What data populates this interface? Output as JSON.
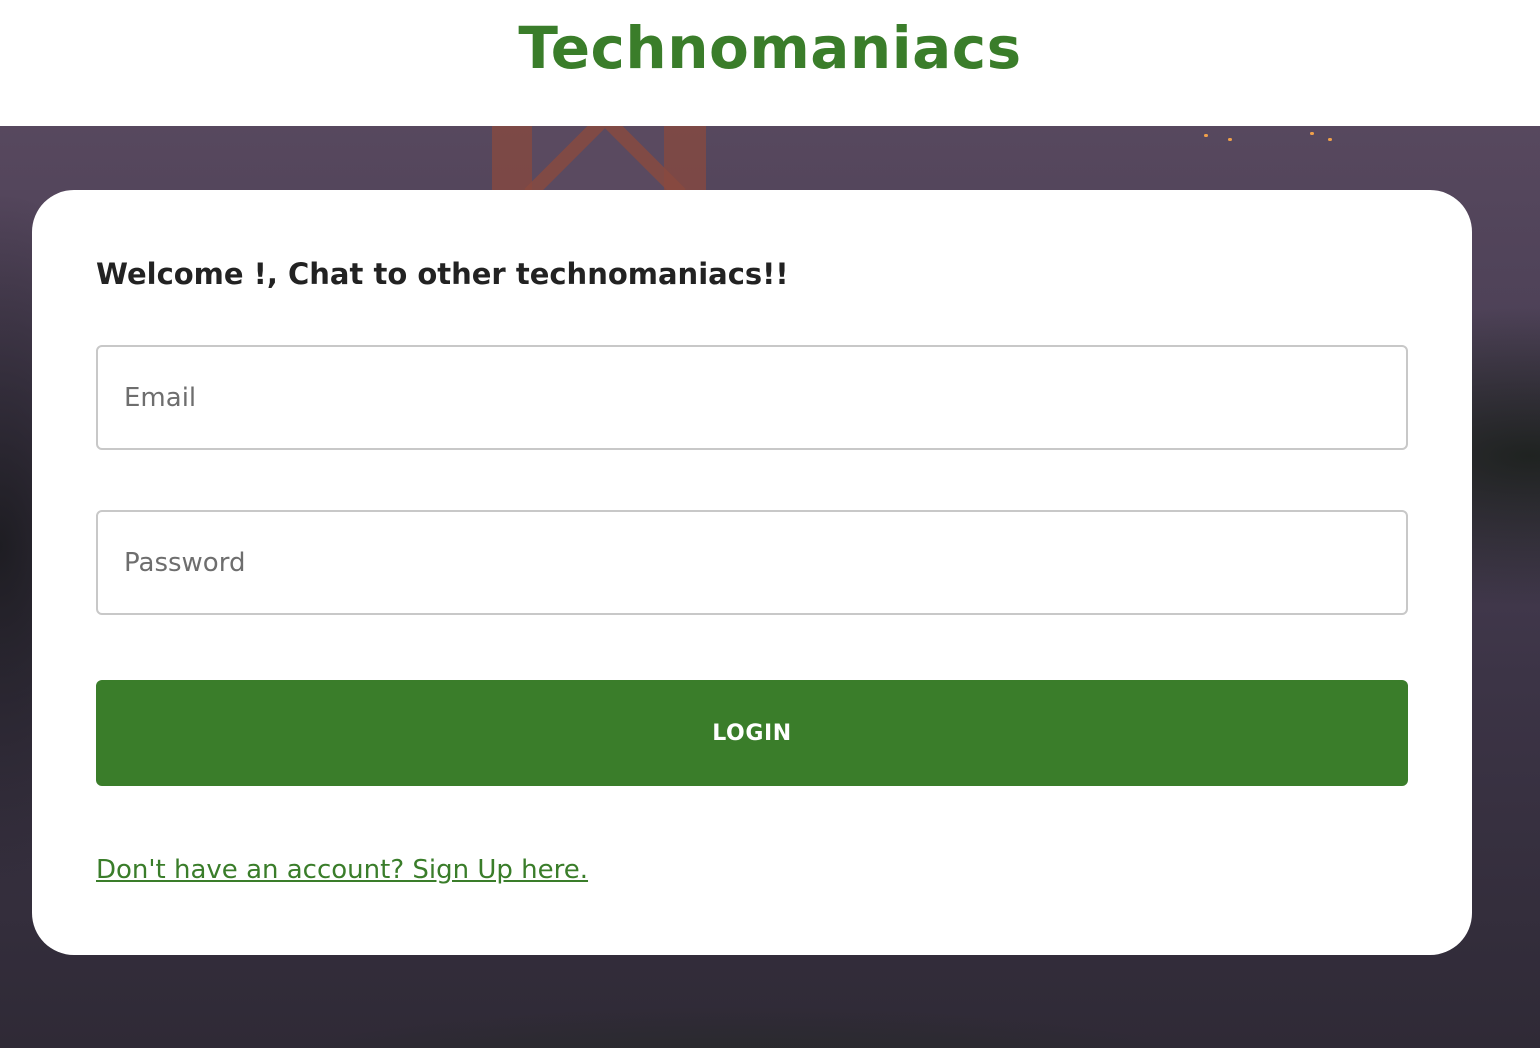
{
  "header": {
    "brand": "Technomaniacs"
  },
  "login_card": {
    "welcome": "Welcome !, Chat to other technomaniacs!!",
    "email": {
      "placeholder": "Email",
      "value": ""
    },
    "password": {
      "placeholder": "Password",
      "value": ""
    },
    "login_label": "LOGIN",
    "signup_link": "Don't have an account? Sign Up here."
  },
  "colors": {
    "brand_green": "#3a7d2a",
    "card_background": "#ffffff",
    "input_border": "#c8c8c8"
  }
}
